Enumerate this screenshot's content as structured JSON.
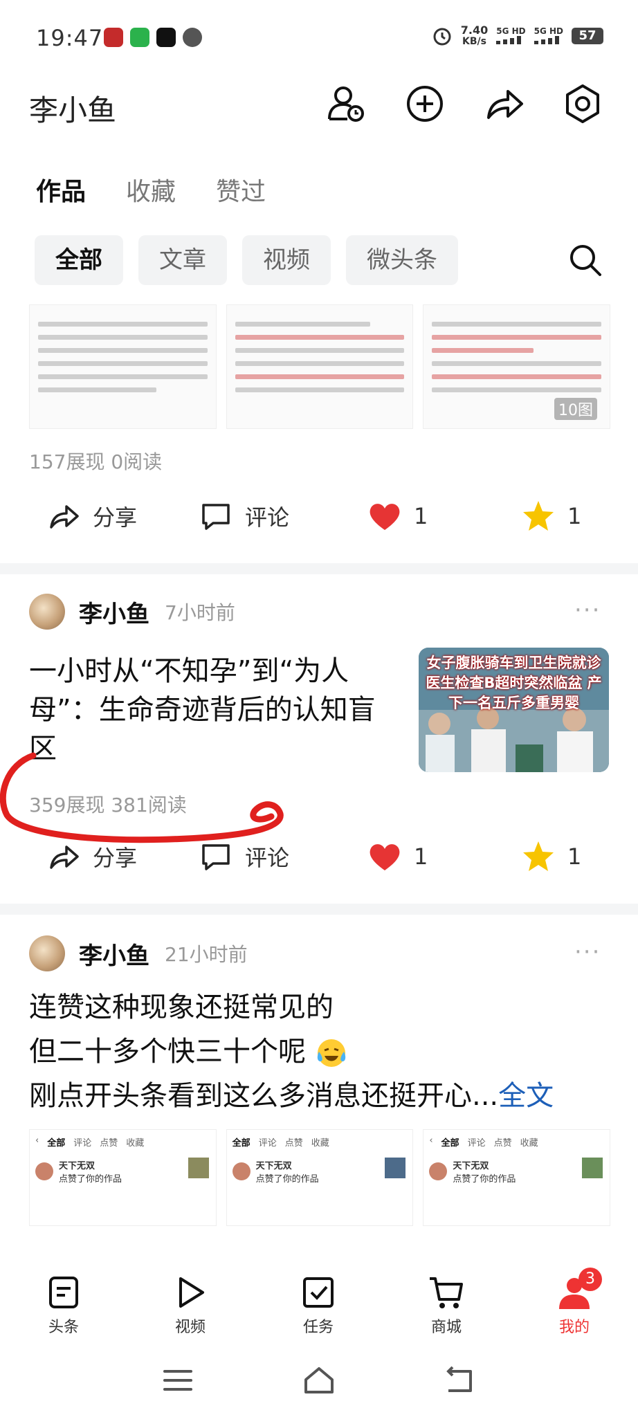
{
  "status_bar": {
    "time": "19:47",
    "speed_value": "7.40",
    "speed_unit": "KB/s",
    "network1": "5G HD",
    "network2": "5G HD",
    "battery": "57"
  },
  "header": {
    "username": "李小鱼",
    "icons": [
      "user-clock-icon",
      "add-circle-icon",
      "share-icon",
      "settings-hex-icon"
    ]
  },
  "primary_tabs": [
    "作品",
    "收藏",
    "赞过"
  ],
  "filter_tabs": [
    "全部",
    "文章",
    "视频",
    "微头条"
  ],
  "post1": {
    "thumb_badge": "10图",
    "stats": "157展现   0阅读",
    "share": "分享",
    "comment": "评论",
    "likes": "1",
    "favorites": "1"
  },
  "post2": {
    "author": "李小鱼",
    "time": "7小时前",
    "title": "一小时从“不知孕”到“为人母”：生命奇迹背后的认知盲区",
    "image_caption": "女子腹胀骑车到卫生院就诊 医生检查B超时突然临盆 产下一名五斤多重男婴",
    "stats": "359展现   381阅读",
    "share": "分享",
    "comment": "评论",
    "likes": "1",
    "favorites": "1"
  },
  "post3": {
    "author": "李小鱼",
    "time": "21小时前",
    "line1": "连赞这种现象还挺常见的",
    "line2": "但二十多个快三十个呢",
    "line3": "刚点开头条看到这么多消息还挺开心...",
    "full_text": "全文",
    "shot_tabs": [
      "全部",
      "评论",
      "点赞",
      "收藏"
    ],
    "shot_user": "天下无双",
    "shot_action": "点赞了你的作品"
  },
  "bottom_nav": [
    {
      "label": "头条",
      "icon": "headline-icon"
    },
    {
      "label": "视频",
      "icon": "play-icon"
    },
    {
      "label": "任务",
      "icon": "task-check-icon"
    },
    {
      "label": "商城",
      "icon": "cart-icon"
    },
    {
      "label": "我的",
      "icon": "profile-icon",
      "badge": "3"
    }
  ],
  "colors": {
    "accent_red": "#e33333",
    "link_blue": "#1d5fb8",
    "star_yellow": "#f7c400"
  }
}
